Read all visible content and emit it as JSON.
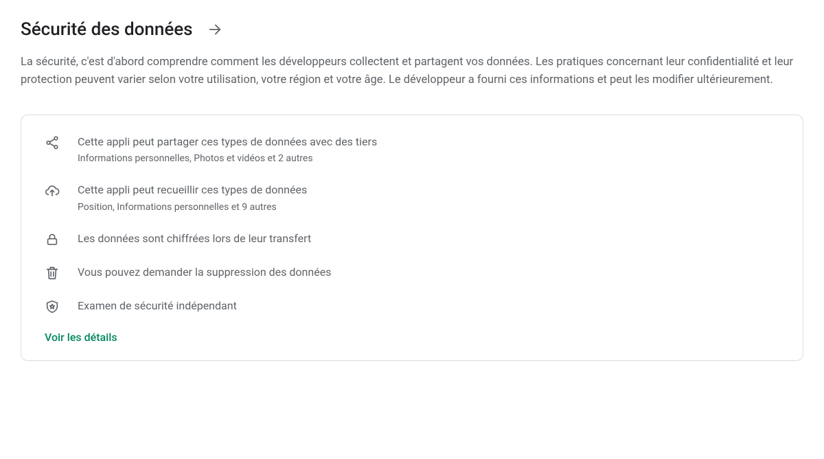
{
  "header": {
    "title": "Sécurité des données"
  },
  "description": "La sécurité, c'est d'abord comprendre comment les développeurs collectent et partagent vos données. Les pratiques concernant leur confidentialité et leur protection peuvent varier selon votre utilisation, votre région et votre âge. Le développeur a fourni ces informations et peut les modifier ultérieurement.",
  "card": {
    "items": [
      {
        "icon": "share-icon",
        "title": "Cette appli peut partager ces types de données avec des tiers",
        "subtitle": "Informations personnelles, Photos et vidéos et 2 autres"
      },
      {
        "icon": "cloud-upload-icon",
        "title": "Cette appli peut recueillir ces types de données",
        "subtitle": "Position, Informations personnelles et 9 autres"
      },
      {
        "icon": "lock-icon",
        "title": "Les données sont chiffrées lors de leur transfert",
        "subtitle": ""
      },
      {
        "icon": "trash-icon",
        "title": "Vous pouvez demander la suppression des données",
        "subtitle": ""
      },
      {
        "icon": "shield-icon",
        "title": "Examen de sécurité indépendant",
        "subtitle": ""
      }
    ],
    "details_link": "Voir les détails"
  }
}
